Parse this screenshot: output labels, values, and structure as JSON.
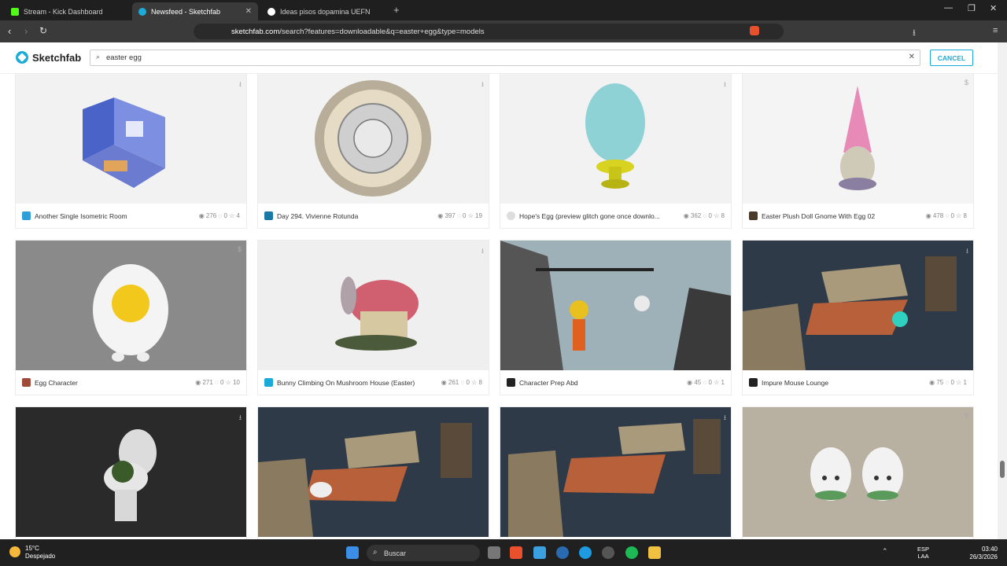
{
  "tabs": [
    {
      "label": "Stream - Kick Dashboard",
      "color": "#53fc18"
    },
    {
      "label": "Newsfeed - Sketchfab",
      "color": "#1caad9"
    },
    {
      "label": "Ideas pisos dopamina UEFN",
      "color": "#ffffff"
    }
  ],
  "address": {
    "host": "sketchfab.com",
    "path": "/search?features=downloadable&q=easter+egg&type=models"
  },
  "header": {
    "brand": "Sketchfab",
    "search_value": "easter egg",
    "cancel_label": "CANCEL"
  },
  "cards": [
    {
      "title": "Another Single Isometric Room",
      "views": "276",
      "comments": "0",
      "likes": "4",
      "avatar": "#2f9fd8"
    },
    {
      "title": "Day 294. Vivienne Rotunda",
      "views": "397",
      "comments": "0",
      "likes": "19",
      "avatar": "#1a7aa5"
    },
    {
      "title": "Hope's Egg (preview glitch gone once downlo...",
      "views": "362",
      "comments": "0",
      "likes": "8",
      "avatar": "#dddddd"
    },
    {
      "title": "Easter Plush Doll Gnome With Egg 02",
      "views": "478",
      "comments": "0",
      "likes": "8",
      "avatar": "#4a3a2a"
    },
    {
      "title": "Egg Character",
      "views": "271",
      "comments": "0",
      "likes": "10",
      "avatar": "#a04a3a"
    },
    {
      "title": "Bunny Climbing On Mushroom House (Easter)",
      "views": "261",
      "comments": "0",
      "likes": "8",
      "avatar": "#1caad9"
    },
    {
      "title": "Character Prep Abd",
      "views": "45",
      "comments": "0",
      "likes": "1",
      "avatar": "#222222"
    },
    {
      "title": "Impure Mouse Lounge",
      "views": "75",
      "comments": "0",
      "likes": "1",
      "avatar": "#222222"
    }
  ],
  "taskbar": {
    "temp": "15°C",
    "condition": "Despejado",
    "search_label": "Buscar",
    "lang": "ESP",
    "lang2": "LAA",
    "time": "03:40",
    "date": "26/3/2026"
  }
}
